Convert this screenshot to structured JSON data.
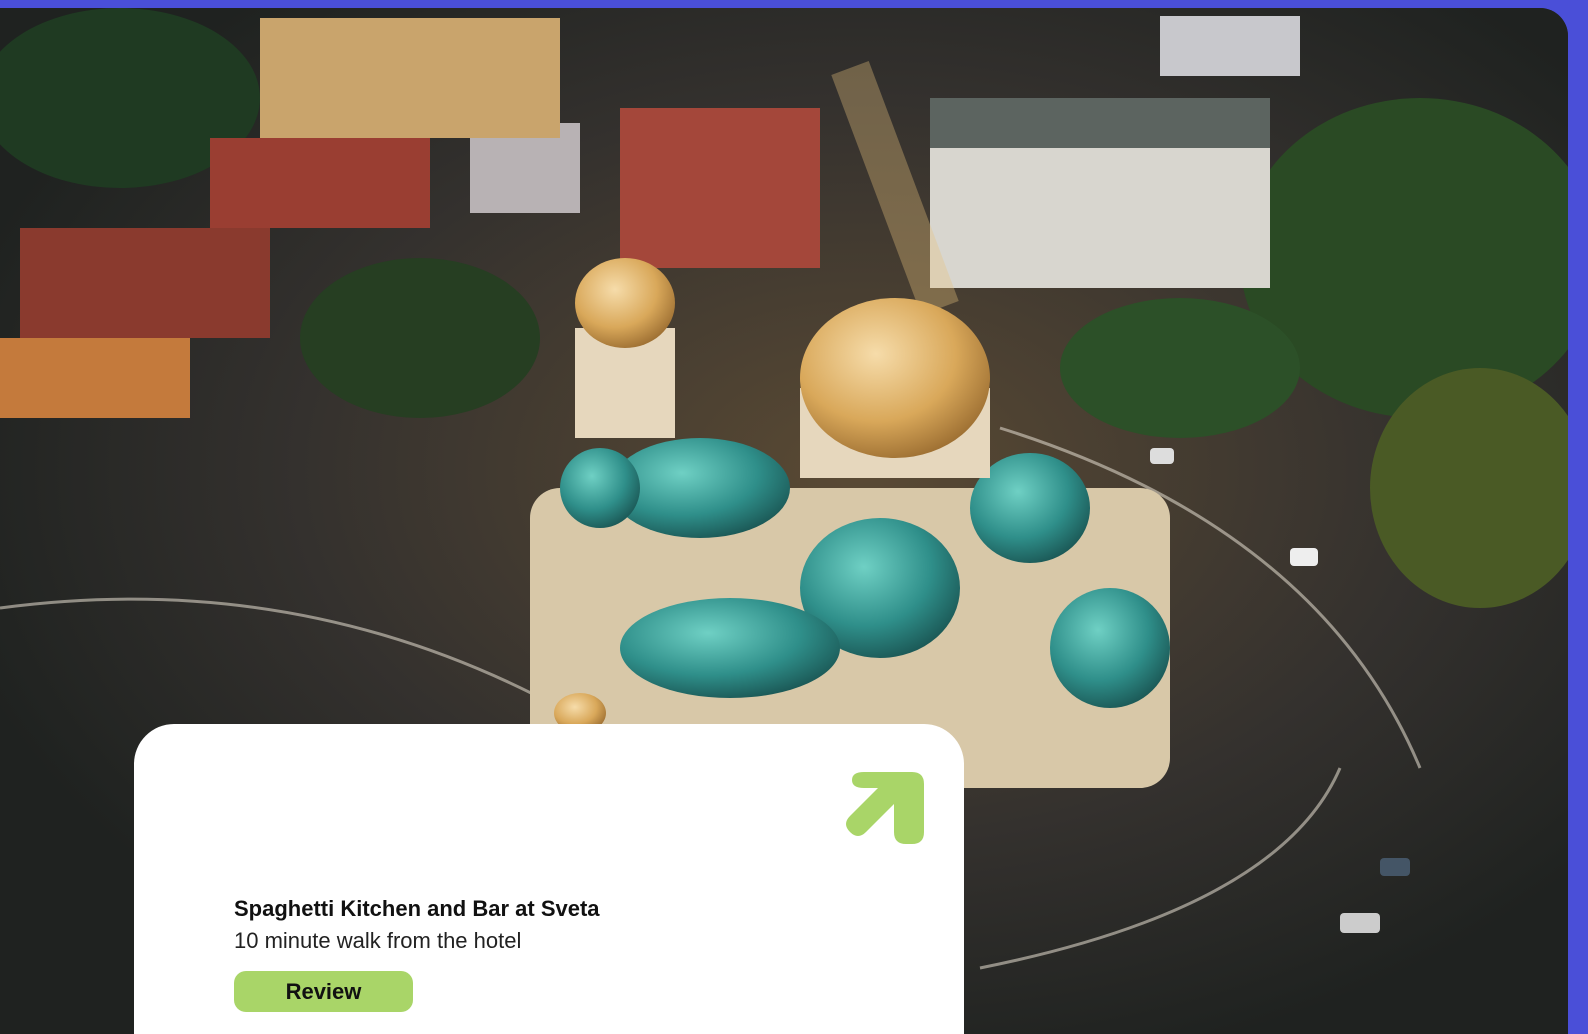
{
  "card": {
    "title": "Spaghetti Kitchen and Bar at Sveta",
    "subtitle": "10 minute walk from the hotel",
    "review_label": "Review",
    "arrow_icon": "arrow-up-right-icon"
  },
  "colors": {
    "frame": "#4a4fd8",
    "card_bg": "#ffffff",
    "accent_green": "#a9d568",
    "dome_gold": "#d9a85a",
    "dome_teal": "#2f8f8a"
  }
}
